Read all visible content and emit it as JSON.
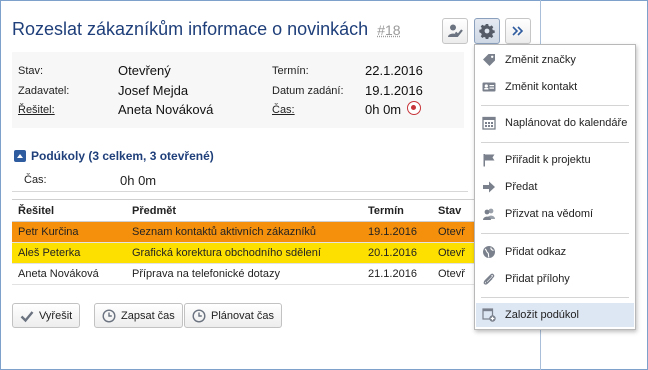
{
  "header": {
    "title": "Rozeslat zákazníkům informace o novinkách",
    "number": "#18"
  },
  "toolbar": {
    "approve_icon": "user-check-icon",
    "settings_icon": "gear-icon",
    "more_icon": "double-chevron-right-icon"
  },
  "info": {
    "stav_label": "Stav:",
    "stav_value": "Otevřený",
    "zadavatel_label": "Zadavatel:",
    "zadavatel_value": "Josef Mejda",
    "resitel_label": "Řešitel:",
    "resitel_value": "Aneta Nováková",
    "termin_label": "Termín:",
    "termin_value": "22.1.2016",
    "datum_label": "Datum zadání:",
    "datum_value": "19.1.2016",
    "cas_label": "Čas:",
    "cas_value": "0h 0m"
  },
  "subtasks": {
    "heading": "Podúkoly (3 celkem, 3 otevřené)",
    "cas_label": "Čas:",
    "cas_value": "0h 0m",
    "columns": [
      "Řešitel",
      "Předmět",
      "Termín",
      "Stav"
    ],
    "rows": [
      {
        "resitel": "Petr Kurčina",
        "predmet": "Seznam kontaktů aktivních zákazníků",
        "termin": "19.1.2016",
        "stav": "Otevř",
        "color": "#f5900d"
      },
      {
        "resitel": "Aleš Peterka",
        "predmet": "Grafická korektura obchodního sdělení",
        "termin": "20.1.2016",
        "stav": "Otevř",
        "color": "#fde000"
      },
      {
        "resitel": "Aneta Nováková",
        "predmet": "Příprava na telefonické dotazy",
        "termin": "21.1.2016",
        "stav": "Otevř",
        "color": "#ffffff"
      }
    ]
  },
  "actions": {
    "vyresit": "Vyřešit",
    "zapsat_cas": "Zapsat čas",
    "planovat_cas": "Plánovat čas"
  },
  "menu": {
    "items": [
      {
        "label": "Změnit značky",
        "icon": "tag-icon"
      },
      {
        "label": "Změnit kontakt",
        "icon": "contact-card-icon"
      },
      {
        "label": "Naplánovat do kalendáře",
        "icon": "calendar-icon"
      },
      {
        "label": "Přiřadit k projektu",
        "icon": "flag-icon"
      },
      {
        "label": "Předat",
        "icon": "arrow-right-icon"
      },
      {
        "label": "Přizvat na vědomí",
        "icon": "users-icon"
      },
      {
        "label": "Přidat odkaz",
        "icon": "globe-icon"
      },
      {
        "label": "Přidat přílohy",
        "icon": "paperclip-icon"
      },
      {
        "label": "Založit podúkol",
        "icon": "add-subtask-icon"
      }
    ],
    "highlighted_index": 8
  },
  "colors": {
    "title": "#1f3f7a",
    "row_orange": "#f5900d",
    "row_yellow": "#fde000",
    "record": "#c7353a",
    "menu_highlight": "#dde6f3"
  }
}
